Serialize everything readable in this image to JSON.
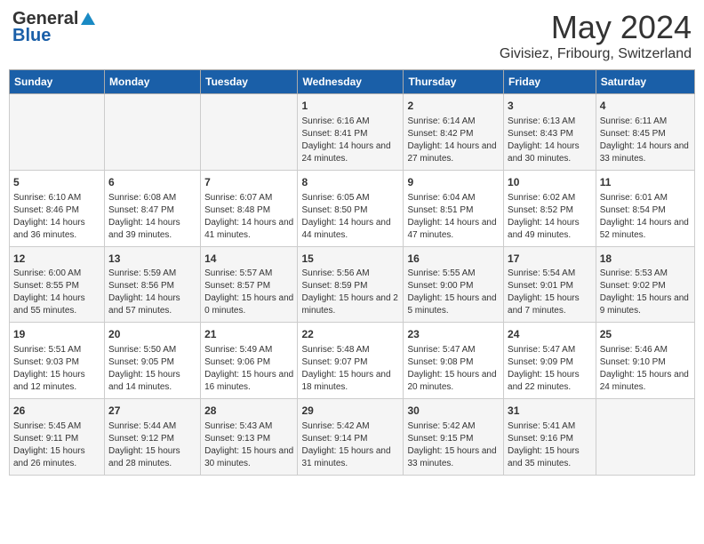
{
  "logo": {
    "general": "General",
    "blue": "Blue"
  },
  "title": "May 2024",
  "subtitle": "Givisiez, Fribourg, Switzerland",
  "days_of_week": [
    "Sunday",
    "Monday",
    "Tuesday",
    "Wednesday",
    "Thursday",
    "Friday",
    "Saturday"
  ],
  "weeks": [
    [
      {
        "day": "",
        "sunrise": "",
        "sunset": "",
        "daylight": ""
      },
      {
        "day": "",
        "sunrise": "",
        "sunset": "",
        "daylight": ""
      },
      {
        "day": "",
        "sunrise": "",
        "sunset": "",
        "daylight": ""
      },
      {
        "day": "1",
        "sunrise": "Sunrise: 6:16 AM",
        "sunset": "Sunset: 8:41 PM",
        "daylight": "Daylight: 14 hours and 24 minutes."
      },
      {
        "day": "2",
        "sunrise": "Sunrise: 6:14 AM",
        "sunset": "Sunset: 8:42 PM",
        "daylight": "Daylight: 14 hours and 27 minutes."
      },
      {
        "day": "3",
        "sunrise": "Sunrise: 6:13 AM",
        "sunset": "Sunset: 8:43 PM",
        "daylight": "Daylight: 14 hours and 30 minutes."
      },
      {
        "day": "4",
        "sunrise": "Sunrise: 6:11 AM",
        "sunset": "Sunset: 8:45 PM",
        "daylight": "Daylight: 14 hours and 33 minutes."
      }
    ],
    [
      {
        "day": "5",
        "sunrise": "Sunrise: 6:10 AM",
        "sunset": "Sunset: 8:46 PM",
        "daylight": "Daylight: 14 hours and 36 minutes."
      },
      {
        "day": "6",
        "sunrise": "Sunrise: 6:08 AM",
        "sunset": "Sunset: 8:47 PM",
        "daylight": "Daylight: 14 hours and 39 minutes."
      },
      {
        "day": "7",
        "sunrise": "Sunrise: 6:07 AM",
        "sunset": "Sunset: 8:48 PM",
        "daylight": "Daylight: 14 hours and 41 minutes."
      },
      {
        "day": "8",
        "sunrise": "Sunrise: 6:05 AM",
        "sunset": "Sunset: 8:50 PM",
        "daylight": "Daylight: 14 hours and 44 minutes."
      },
      {
        "day": "9",
        "sunrise": "Sunrise: 6:04 AM",
        "sunset": "Sunset: 8:51 PM",
        "daylight": "Daylight: 14 hours and 47 minutes."
      },
      {
        "day": "10",
        "sunrise": "Sunrise: 6:02 AM",
        "sunset": "Sunset: 8:52 PM",
        "daylight": "Daylight: 14 hours and 49 minutes."
      },
      {
        "day": "11",
        "sunrise": "Sunrise: 6:01 AM",
        "sunset": "Sunset: 8:54 PM",
        "daylight": "Daylight: 14 hours and 52 minutes."
      }
    ],
    [
      {
        "day": "12",
        "sunrise": "Sunrise: 6:00 AM",
        "sunset": "Sunset: 8:55 PM",
        "daylight": "Daylight: 14 hours and 55 minutes."
      },
      {
        "day": "13",
        "sunrise": "Sunrise: 5:59 AM",
        "sunset": "Sunset: 8:56 PM",
        "daylight": "Daylight: 14 hours and 57 minutes."
      },
      {
        "day": "14",
        "sunrise": "Sunrise: 5:57 AM",
        "sunset": "Sunset: 8:57 PM",
        "daylight": "Daylight: 15 hours and 0 minutes."
      },
      {
        "day": "15",
        "sunrise": "Sunrise: 5:56 AM",
        "sunset": "Sunset: 8:59 PM",
        "daylight": "Daylight: 15 hours and 2 minutes."
      },
      {
        "day": "16",
        "sunrise": "Sunrise: 5:55 AM",
        "sunset": "Sunset: 9:00 PM",
        "daylight": "Daylight: 15 hours and 5 minutes."
      },
      {
        "day": "17",
        "sunrise": "Sunrise: 5:54 AM",
        "sunset": "Sunset: 9:01 PM",
        "daylight": "Daylight: 15 hours and 7 minutes."
      },
      {
        "day": "18",
        "sunrise": "Sunrise: 5:53 AM",
        "sunset": "Sunset: 9:02 PM",
        "daylight": "Daylight: 15 hours and 9 minutes."
      }
    ],
    [
      {
        "day": "19",
        "sunrise": "Sunrise: 5:51 AM",
        "sunset": "Sunset: 9:03 PM",
        "daylight": "Daylight: 15 hours and 12 minutes."
      },
      {
        "day": "20",
        "sunrise": "Sunrise: 5:50 AM",
        "sunset": "Sunset: 9:05 PM",
        "daylight": "Daylight: 15 hours and 14 minutes."
      },
      {
        "day": "21",
        "sunrise": "Sunrise: 5:49 AM",
        "sunset": "Sunset: 9:06 PM",
        "daylight": "Daylight: 15 hours and 16 minutes."
      },
      {
        "day": "22",
        "sunrise": "Sunrise: 5:48 AM",
        "sunset": "Sunset: 9:07 PM",
        "daylight": "Daylight: 15 hours and 18 minutes."
      },
      {
        "day": "23",
        "sunrise": "Sunrise: 5:47 AM",
        "sunset": "Sunset: 9:08 PM",
        "daylight": "Daylight: 15 hours and 20 minutes."
      },
      {
        "day": "24",
        "sunrise": "Sunrise: 5:47 AM",
        "sunset": "Sunset: 9:09 PM",
        "daylight": "Daylight: 15 hours and 22 minutes."
      },
      {
        "day": "25",
        "sunrise": "Sunrise: 5:46 AM",
        "sunset": "Sunset: 9:10 PM",
        "daylight": "Daylight: 15 hours and 24 minutes."
      }
    ],
    [
      {
        "day": "26",
        "sunrise": "Sunrise: 5:45 AM",
        "sunset": "Sunset: 9:11 PM",
        "daylight": "Daylight: 15 hours and 26 minutes."
      },
      {
        "day": "27",
        "sunrise": "Sunrise: 5:44 AM",
        "sunset": "Sunset: 9:12 PM",
        "daylight": "Daylight: 15 hours and 28 minutes."
      },
      {
        "day": "28",
        "sunrise": "Sunrise: 5:43 AM",
        "sunset": "Sunset: 9:13 PM",
        "daylight": "Daylight: 15 hours and 30 minutes."
      },
      {
        "day": "29",
        "sunrise": "Sunrise: 5:42 AM",
        "sunset": "Sunset: 9:14 PM",
        "daylight": "Daylight: 15 hours and 31 minutes."
      },
      {
        "day": "30",
        "sunrise": "Sunrise: 5:42 AM",
        "sunset": "Sunset: 9:15 PM",
        "daylight": "Daylight: 15 hours and 33 minutes."
      },
      {
        "day": "31",
        "sunrise": "Sunrise: 5:41 AM",
        "sunset": "Sunset: 9:16 PM",
        "daylight": "Daylight: 15 hours and 35 minutes."
      },
      {
        "day": "",
        "sunrise": "",
        "sunset": "",
        "daylight": ""
      }
    ]
  ]
}
